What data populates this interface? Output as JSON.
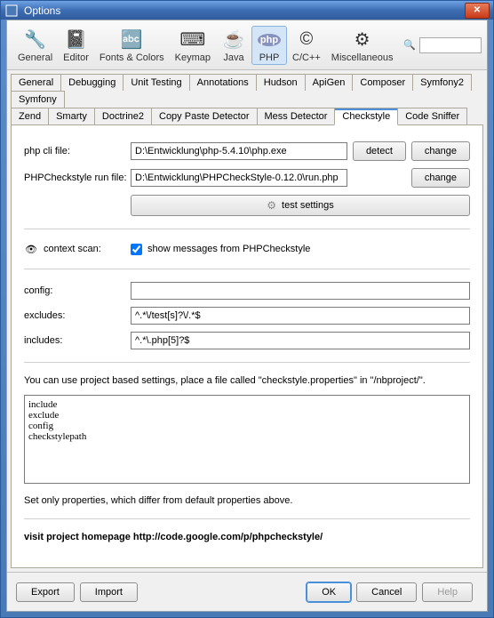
{
  "window": {
    "title": "Options"
  },
  "toolbar": {
    "items": [
      {
        "label": "General"
      },
      {
        "label": "Editor"
      },
      {
        "label": "Fonts & Colors"
      },
      {
        "label": "Keymap"
      },
      {
        "label": "Java"
      },
      {
        "label": "PHP"
      },
      {
        "label": "C/C++"
      },
      {
        "label": "Miscellaneous"
      }
    ]
  },
  "tabs_row1": [
    "General",
    "Debugging",
    "Unit Testing",
    "Annotations",
    "Hudson",
    "ApiGen",
    "Composer",
    "Symfony2",
    "Symfony"
  ],
  "tabs_row2": [
    "Zend",
    "Smarty",
    "Doctrine2",
    "Copy Paste Detector",
    "Mess Detector",
    "Checkstyle",
    "Code Sniffer"
  ],
  "form": {
    "php_cli_label": "php cli file:",
    "php_cli_value": "D:\\Entwicklung\\php-5.4.10\\php.exe",
    "detect": "detect",
    "change": "change",
    "run_file_label": "PHPCheckstyle run file:",
    "run_file_value": "D:\\Entwicklung\\PHPCheckStyle-0.12.0\\run.php",
    "test_settings": "test settings",
    "context_label": "context scan:",
    "show_messages": "show messages from PHPCheckstyle",
    "config_label": "config:",
    "config_value": "",
    "excludes_label": "excludes:",
    "excludes_value": "^.*\\/test[s]?\\/.*$",
    "includes_label": "includes:",
    "includes_value": "^.*\\.php[5]?$",
    "project_note": "You can use project based settings, place a file called \"checkstyle.properties\" in \"/nbproject/\".",
    "textarea_content": "include\nexclude\nconfig\ncheckstylepath",
    "diff_note": "Set only properties, which differ from default properties above.",
    "homepage": "visit project homepage http://code.google.com/p/phpcheckstyle/"
  },
  "bottom": {
    "export": "Export",
    "import": "Import",
    "ok": "OK",
    "cancel": "Cancel",
    "help": "Help"
  }
}
